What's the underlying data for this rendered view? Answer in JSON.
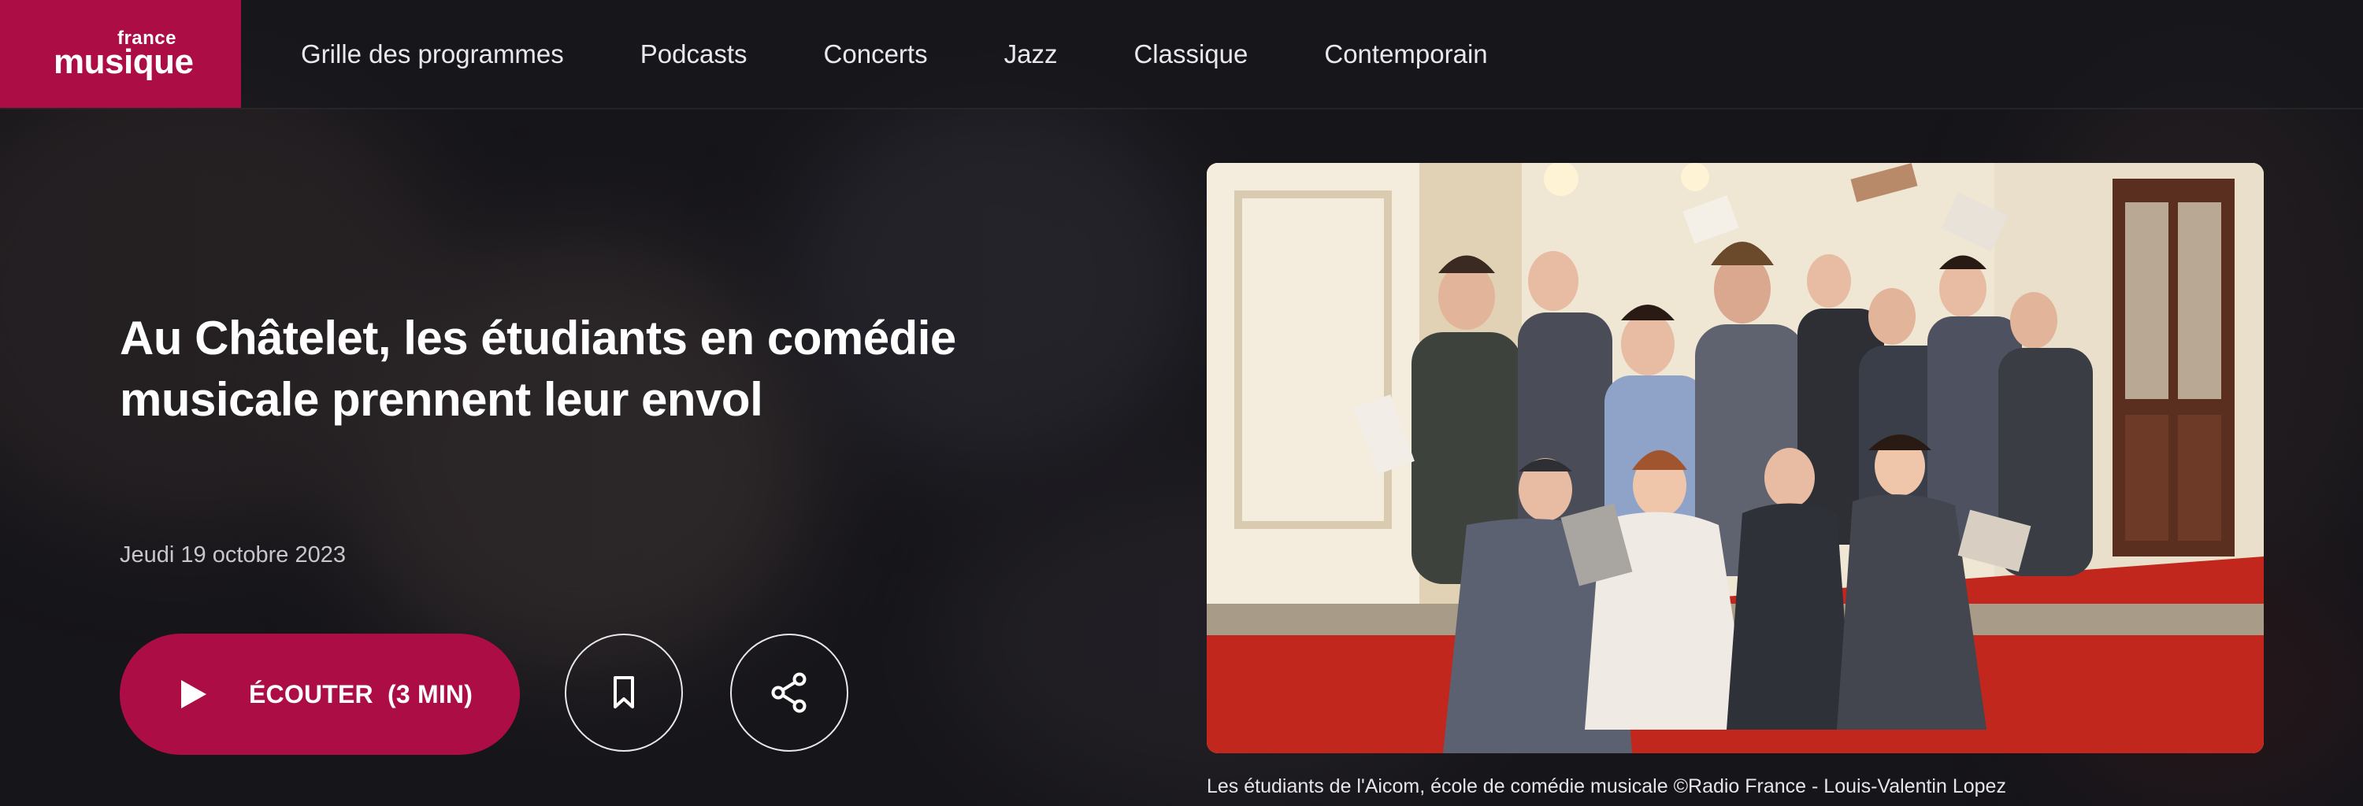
{
  "brand": {
    "logo_top": "france",
    "logo_bottom": "musique",
    "color": "#ad0d45"
  },
  "nav": {
    "items": [
      {
        "label": "Grille des programmes"
      },
      {
        "label": "Podcasts"
      },
      {
        "label": "Concerts"
      },
      {
        "label": "Jazz"
      },
      {
        "label": "Classique"
      },
      {
        "label": "Contemporain"
      }
    ]
  },
  "article": {
    "title": "Au Châtelet, les étudiants en comédie musicale prennent leur envol",
    "date": "Jeudi 19 octobre 2023",
    "listen_label": "ÉCOUTER  (3 MIN)",
    "caption": "Les étudiants de l'Aicom, école de comédie musicale ©Radio France - Louis-Valentin Lopez"
  },
  "icons": {
    "play": "play-icon",
    "bookmark": "bookmark-icon",
    "share": "share-icon"
  }
}
